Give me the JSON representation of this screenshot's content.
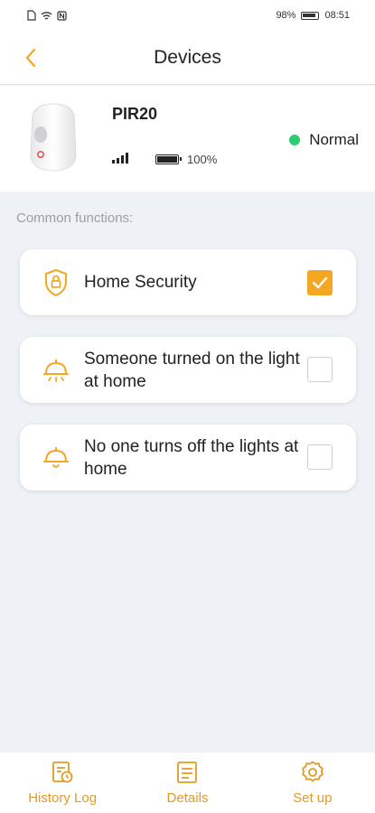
{
  "status_bar": {
    "battery_percent": "98%",
    "time": "08:51",
    "icons": [
      "sim-card-icon",
      "wifi-icon",
      "nfc-icon"
    ]
  },
  "header": {
    "title": "Devices",
    "back_icon": "chevron-left-icon"
  },
  "device": {
    "name": "PIR20",
    "signal_icon": "signal-strength-icon",
    "battery_level": "100%",
    "status_text": "Normal",
    "status_color": "#2ecc71"
  },
  "functions": {
    "section_title": "Common functions:",
    "items": [
      {
        "label": "Home Security",
        "icon": "shield-lock-icon",
        "checked": true
      },
      {
        "label": "Someone turned on the light at home",
        "icon": "light-on-icon",
        "checked": false
      },
      {
        "label": "No one turns off the lights at home",
        "icon": "light-off-icon",
        "checked": false
      }
    ]
  },
  "bottom_nav": {
    "items": [
      {
        "label": "History Log",
        "icon": "history-log-icon"
      },
      {
        "label": "Details",
        "icon": "details-icon"
      },
      {
        "label": "Set up",
        "icon": "gear-icon"
      }
    ]
  },
  "colors": {
    "accent": "#f5a623",
    "nav_text": "#e39a23",
    "background": "#eef1f6"
  }
}
